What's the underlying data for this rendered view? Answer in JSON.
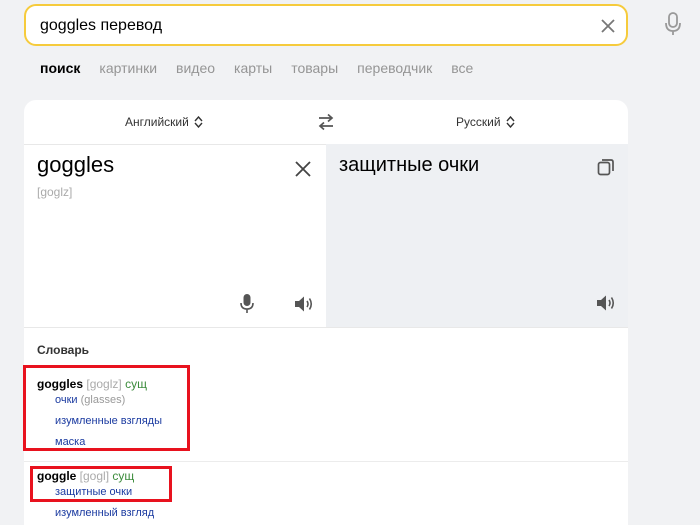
{
  "search": {
    "value": "goggles перевод"
  },
  "nav": {
    "tabs": [
      "поиск",
      "картинки",
      "видео",
      "карты",
      "товары",
      "переводчик",
      "все"
    ]
  },
  "translator": {
    "source_lang": "Английский",
    "target_lang": "Русский",
    "source_word": "goggles",
    "source_transcription": "[goglz]",
    "translation": "защитные очки"
  },
  "dictionary": {
    "title": "Словарь",
    "entries": [
      {
        "word": "goggles",
        "transcription": "[goglz]",
        "pos": "сущ",
        "senses": [
          {
            "text": "очки",
            "note": "(glasses)"
          },
          {
            "text": "изумленные взгляды"
          },
          {
            "text": "маска"
          }
        ]
      },
      {
        "word": "goggle",
        "transcription": "[gogl]",
        "pos": "сущ",
        "senses": [
          {
            "text": "защитные очки"
          },
          {
            "text": "изумленный взгляд"
          }
        ]
      }
    ]
  },
  "colors": {
    "search_border": "#f6cb3c",
    "annotation": "#e8121e",
    "sense_link": "#1a3aa0",
    "pos": "#3c8c3c"
  }
}
